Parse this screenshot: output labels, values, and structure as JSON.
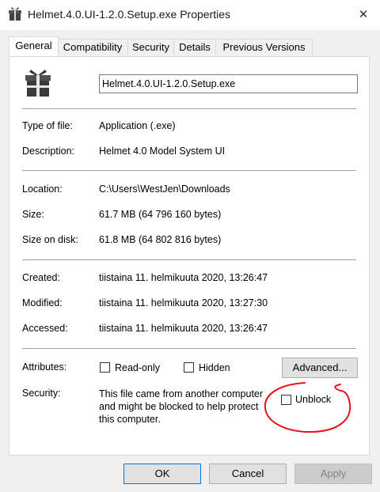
{
  "window": {
    "title": "Helmet.4.0.UI-1.2.0.Setup.exe Properties",
    "close_glyph": "✕"
  },
  "tabs": [
    {
      "label": "General"
    },
    {
      "label": "Compatibility"
    },
    {
      "label": "Security"
    },
    {
      "label": "Details"
    },
    {
      "label": "Previous Versions"
    }
  ],
  "file": {
    "name": "Helmet.4.0.UI-1.2.0.Setup.exe",
    "icon": "installer-package-icon"
  },
  "labels": {
    "type": "Type of file:",
    "description": "Description:",
    "location": "Location:",
    "size": "Size:",
    "size_on_disk": "Size on disk:",
    "created": "Created:",
    "modified": "Modified:",
    "accessed": "Accessed:",
    "attributes": "Attributes:",
    "security": "Security:"
  },
  "values": {
    "type": "Application (.exe)",
    "description": "Helmet 4.0 Model System UI",
    "location": "C:\\Users\\WestJen\\Downloads",
    "size": "61.7 MB (64 796 160 bytes)",
    "size_on_disk": "61.8 MB (64 802 816 bytes)",
    "created": "tiistaina 11. helmikuuta 2020, 13:26:47",
    "modified": "tiistaina 11. helmikuuta 2020, 13:27:30",
    "accessed": "tiistaina 11. helmikuuta 2020, 13:26:47"
  },
  "attributes": {
    "read_only": {
      "label": "Read-only",
      "checked": false
    },
    "hidden": {
      "label": "Hidden",
      "checked": false
    },
    "advanced_button": "Advanced..."
  },
  "security": {
    "line1": "This file came from another computer",
    "line2": "and might be blocked to help protect",
    "line3": "this computer.",
    "unblock_label": "Unblock",
    "unblock_checked": false
  },
  "buttons": {
    "ok": "OK",
    "cancel": "Cancel",
    "apply": "Apply"
  },
  "colors": {
    "annotation": "#e8101c",
    "focus": "#0078d7"
  }
}
